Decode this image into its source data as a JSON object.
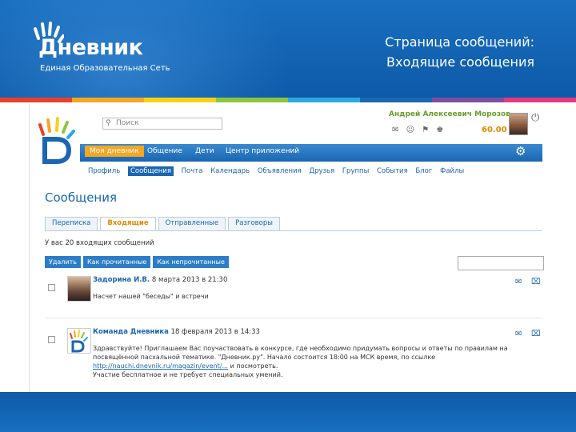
{
  "header": {
    "logo_word": "Дневник",
    "logo_subtitle": "Единая Образовательная Сеть",
    "title_line1": "Страница сообщений:",
    "title_line2": "Входящие сообщения"
  },
  "stripes": [
    "#e8412a",
    "#f5a623",
    "#f7d117",
    "#8cc63f",
    "#2aa9e0",
    "#1a66b2",
    "#7b4fa0",
    "#e6397f"
  ],
  "app": {
    "search_placeholder": "Поиск",
    "user_name": "Андрей Алексеевич Морозов",
    "score": "60.00",
    "nav": [
      "Моя дневник",
      "Общение",
      "Дети",
      "Центр приложений"
    ],
    "subnav": [
      "Профиль",
      "Сообщения",
      "Почта",
      "Календарь",
      "Объявления",
      "Друзья",
      "Группы",
      "События",
      "Блог",
      "Файлы"
    ],
    "page_title": "Сообщения",
    "tabs": [
      "Переписка",
      "Входящие",
      "Отправленные",
      "Разговоры"
    ],
    "count_text": "У вас 20 входящих сообщений",
    "actions": [
      "Удалить",
      "Как прочитанные",
      "Как непрочитанные"
    ],
    "messages": [
      {
        "sender": "Задорина И.В.",
        "date": "8 марта 2013 в 21:30",
        "text": "Насчет нашей \"беседы\" и встречи"
      },
      {
        "sender": "Команда Дневника",
        "date": "18 февраля 2013 в 14:33",
        "text_before": "Здравствуйте! Приглашаем Вас поучаствовать в конкурсе, где необходимо придумать вопросы и ответы по правилам на посвящённой пасхальной тематике. \"Дневник.ру\". Начало состоится 18:00 на МСК время, по ссылке",
        "link": "http://nauchi.dnevnik.ru/magazin/event/...",
        "text_after": "и посмотреть.",
        "text_line3": "Участие бесплатное и не требует специальных умений."
      }
    ]
  }
}
